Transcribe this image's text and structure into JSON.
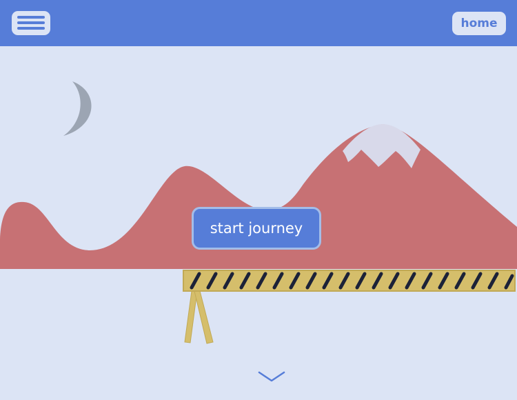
{
  "header": {
    "menu_icon": "hamburger-menu-icon",
    "home_label": "home"
  },
  "hero": {
    "cta_label": "start journey",
    "moon_icon": "crescent-moon-icon",
    "scroll_icon": "chevron-down-icon"
  },
  "colors": {
    "header_bg": "#567dd8",
    "page_bg": "#dce4f5",
    "mountain": "#c77174",
    "snow": "#d8d9ea",
    "moon": "#9ca5b3",
    "barrier_yellow": "#d5be6b",
    "barrier_stripe": "#1c2238"
  }
}
